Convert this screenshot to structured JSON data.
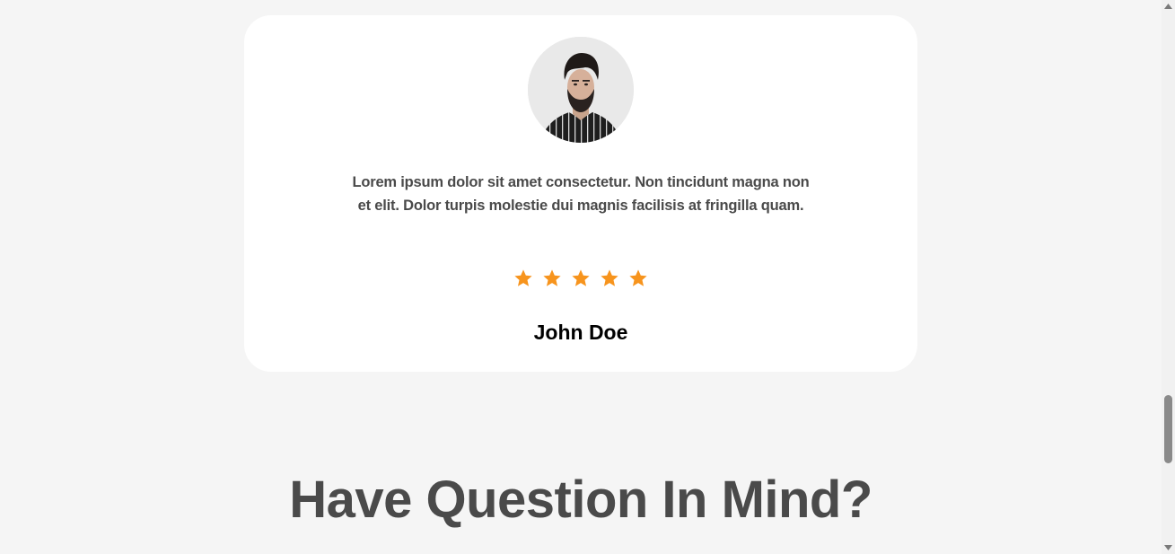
{
  "testimonial": {
    "quote": "Lorem ipsum dolor sit amet consectetur. Non tincidunt magna non et elit. Dolor turpis molestie dui magnis facilisis at fringilla quam.",
    "rating": 5,
    "rating_max": 5,
    "star_color": "#f7941d",
    "name": "John Doe"
  },
  "section": {
    "heading": "Have Question In Mind?"
  },
  "icons": {
    "star": "star-icon",
    "avatar": "person-avatar",
    "scroll_up": "arrow-up-icon",
    "scroll_down": "arrow-down-icon"
  }
}
